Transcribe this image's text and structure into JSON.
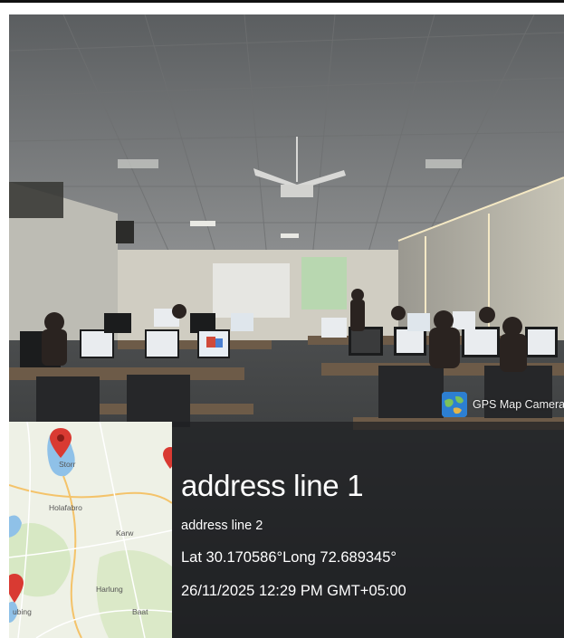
{
  "watermark": {
    "app_name": "GPS Map Camera",
    "icon": "globe-icon"
  },
  "location": {
    "address_line_1": "address line 1",
    "address_line_2": "address line 2",
    "coordinates": "Lat 30.170586°Long 72.689345°",
    "datetime": "26/11/2025 12:29 PM GMT+05:00"
  },
  "map": {
    "place_labels": [
      "Storr",
      "Holafabro",
      "Karw",
      "Harlung",
      "Baat",
      "ubing"
    ],
    "marker_icon": "map-pin-icon"
  },
  "colors": {
    "overlay": "#1e2022",
    "pin": "#d93a32",
    "text": "#ffffff",
    "water": "#8fc1e8"
  }
}
